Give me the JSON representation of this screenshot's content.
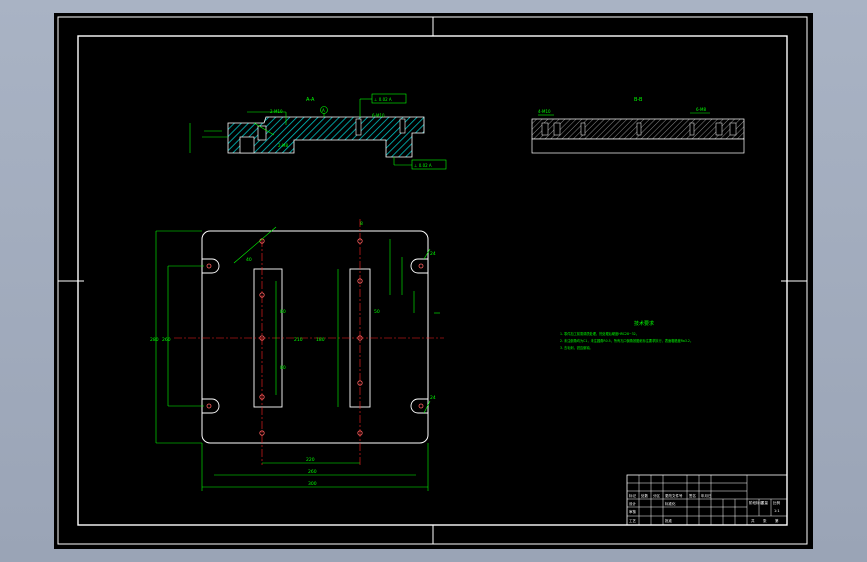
{
  "colors": {
    "background": "#9ea8ba",
    "canvas": "#000000",
    "frame": "#ffffff",
    "part": "#ffffff",
    "dimension": "#00ff00",
    "hatch": "#00c0c0",
    "centerline": "#ff2020",
    "hole": "#ff6060"
  },
  "views": {
    "section_a_label": "A-A",
    "section_b_label": "B-B",
    "datum_label": "A",
    "tolerance_top": "⊥ 0.02 A",
    "tolerance_bottom": "⊥ 0.02 A",
    "callout_a1": "2-M10",
    "callout_a2": "2-M8",
    "callout_a3": "6-M10",
    "callout_b1": "4-M10",
    "callout_b2": "6-M8"
  },
  "dimensions": {
    "overall_width": "300",
    "inner_width": "260",
    "hole_spacing": "220",
    "overall_height": "280",
    "slot_height": "210",
    "slot_inner": "180",
    "left_height": "260",
    "pitch_a": "80",
    "pitch_b": "80",
    "slot_r": "24",
    "small_a": "40",
    "small_b": "50",
    "small_c": "8"
  },
  "notes": {
    "title": "技术要求",
    "line1": "1. 零件加工前需调质处理，热处理后硬度HRC28~32。",
    "line2": "2. 未注倒角均为C1，未注圆角R0.5，所有孔口倒角按图纸标注要求执行，表面粗糙度Ra3.2。",
    "line3": "3. 去毛刺，锐边倒钝。"
  },
  "title_block": {
    "c1": "标记",
    "c2": "处数",
    "c3": "分区",
    "c4": "更改文件号",
    "c5": "签名",
    "c6": "年月日",
    "d1": "设计",
    "d2": "标准化",
    "d3": "审核",
    "d4": "工艺",
    "d5": "批准",
    "m1": "阶段标记",
    "m2": "重量",
    "m3": "比例",
    "m4": "共",
    "m5": "张",
    "m6": "第",
    "scale": "1:1"
  }
}
